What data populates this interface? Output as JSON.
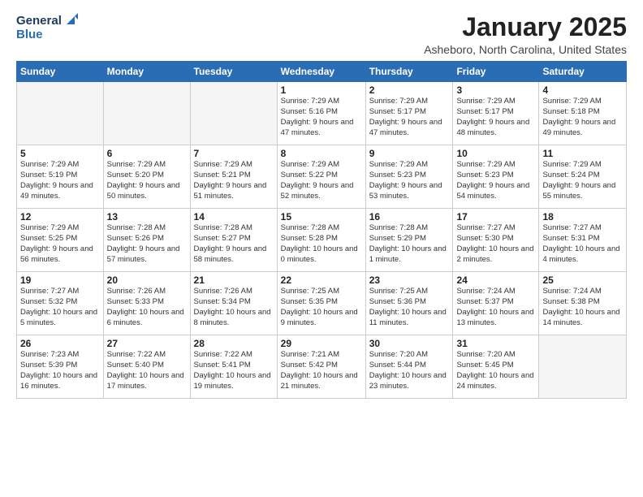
{
  "logo": {
    "line1": "General",
    "line2": "Blue"
  },
  "title": "January 2025",
  "location": "Asheboro, North Carolina, United States",
  "weekdays": [
    "Sunday",
    "Monday",
    "Tuesday",
    "Wednesday",
    "Thursday",
    "Friday",
    "Saturday"
  ],
  "weeks": [
    [
      {
        "day": "",
        "info": ""
      },
      {
        "day": "",
        "info": ""
      },
      {
        "day": "",
        "info": ""
      },
      {
        "day": "1",
        "info": "Sunrise: 7:29 AM\nSunset: 5:16 PM\nDaylight: 9 hours\nand 47 minutes."
      },
      {
        "day": "2",
        "info": "Sunrise: 7:29 AM\nSunset: 5:17 PM\nDaylight: 9 hours\nand 47 minutes."
      },
      {
        "day": "3",
        "info": "Sunrise: 7:29 AM\nSunset: 5:17 PM\nDaylight: 9 hours\nand 48 minutes."
      },
      {
        "day": "4",
        "info": "Sunrise: 7:29 AM\nSunset: 5:18 PM\nDaylight: 9 hours\nand 49 minutes."
      }
    ],
    [
      {
        "day": "5",
        "info": "Sunrise: 7:29 AM\nSunset: 5:19 PM\nDaylight: 9 hours\nand 49 minutes."
      },
      {
        "day": "6",
        "info": "Sunrise: 7:29 AM\nSunset: 5:20 PM\nDaylight: 9 hours\nand 50 minutes."
      },
      {
        "day": "7",
        "info": "Sunrise: 7:29 AM\nSunset: 5:21 PM\nDaylight: 9 hours\nand 51 minutes."
      },
      {
        "day": "8",
        "info": "Sunrise: 7:29 AM\nSunset: 5:22 PM\nDaylight: 9 hours\nand 52 minutes."
      },
      {
        "day": "9",
        "info": "Sunrise: 7:29 AM\nSunset: 5:23 PM\nDaylight: 9 hours\nand 53 minutes."
      },
      {
        "day": "10",
        "info": "Sunrise: 7:29 AM\nSunset: 5:23 PM\nDaylight: 9 hours\nand 54 minutes."
      },
      {
        "day": "11",
        "info": "Sunrise: 7:29 AM\nSunset: 5:24 PM\nDaylight: 9 hours\nand 55 minutes."
      }
    ],
    [
      {
        "day": "12",
        "info": "Sunrise: 7:29 AM\nSunset: 5:25 PM\nDaylight: 9 hours\nand 56 minutes."
      },
      {
        "day": "13",
        "info": "Sunrise: 7:28 AM\nSunset: 5:26 PM\nDaylight: 9 hours\nand 57 minutes."
      },
      {
        "day": "14",
        "info": "Sunrise: 7:28 AM\nSunset: 5:27 PM\nDaylight: 9 hours\nand 58 minutes."
      },
      {
        "day": "15",
        "info": "Sunrise: 7:28 AM\nSunset: 5:28 PM\nDaylight: 10 hours\nand 0 minutes."
      },
      {
        "day": "16",
        "info": "Sunrise: 7:28 AM\nSunset: 5:29 PM\nDaylight: 10 hours\nand 1 minute."
      },
      {
        "day": "17",
        "info": "Sunrise: 7:27 AM\nSunset: 5:30 PM\nDaylight: 10 hours\nand 2 minutes."
      },
      {
        "day": "18",
        "info": "Sunrise: 7:27 AM\nSunset: 5:31 PM\nDaylight: 10 hours\nand 4 minutes."
      }
    ],
    [
      {
        "day": "19",
        "info": "Sunrise: 7:27 AM\nSunset: 5:32 PM\nDaylight: 10 hours\nand 5 minutes."
      },
      {
        "day": "20",
        "info": "Sunrise: 7:26 AM\nSunset: 5:33 PM\nDaylight: 10 hours\nand 6 minutes."
      },
      {
        "day": "21",
        "info": "Sunrise: 7:26 AM\nSunset: 5:34 PM\nDaylight: 10 hours\nand 8 minutes."
      },
      {
        "day": "22",
        "info": "Sunrise: 7:25 AM\nSunset: 5:35 PM\nDaylight: 10 hours\nand 9 minutes."
      },
      {
        "day": "23",
        "info": "Sunrise: 7:25 AM\nSunset: 5:36 PM\nDaylight: 10 hours\nand 11 minutes."
      },
      {
        "day": "24",
        "info": "Sunrise: 7:24 AM\nSunset: 5:37 PM\nDaylight: 10 hours\nand 13 minutes."
      },
      {
        "day": "25",
        "info": "Sunrise: 7:24 AM\nSunset: 5:38 PM\nDaylight: 10 hours\nand 14 minutes."
      }
    ],
    [
      {
        "day": "26",
        "info": "Sunrise: 7:23 AM\nSunset: 5:39 PM\nDaylight: 10 hours\nand 16 minutes."
      },
      {
        "day": "27",
        "info": "Sunrise: 7:22 AM\nSunset: 5:40 PM\nDaylight: 10 hours\nand 17 minutes."
      },
      {
        "day": "28",
        "info": "Sunrise: 7:22 AM\nSunset: 5:41 PM\nDaylight: 10 hours\nand 19 minutes."
      },
      {
        "day": "29",
        "info": "Sunrise: 7:21 AM\nSunset: 5:42 PM\nDaylight: 10 hours\nand 21 minutes."
      },
      {
        "day": "30",
        "info": "Sunrise: 7:20 AM\nSunset: 5:44 PM\nDaylight: 10 hours\nand 23 minutes."
      },
      {
        "day": "31",
        "info": "Sunrise: 7:20 AM\nSunset: 5:45 PM\nDaylight: 10 hours\nand 24 minutes."
      },
      {
        "day": "",
        "info": ""
      }
    ]
  ]
}
